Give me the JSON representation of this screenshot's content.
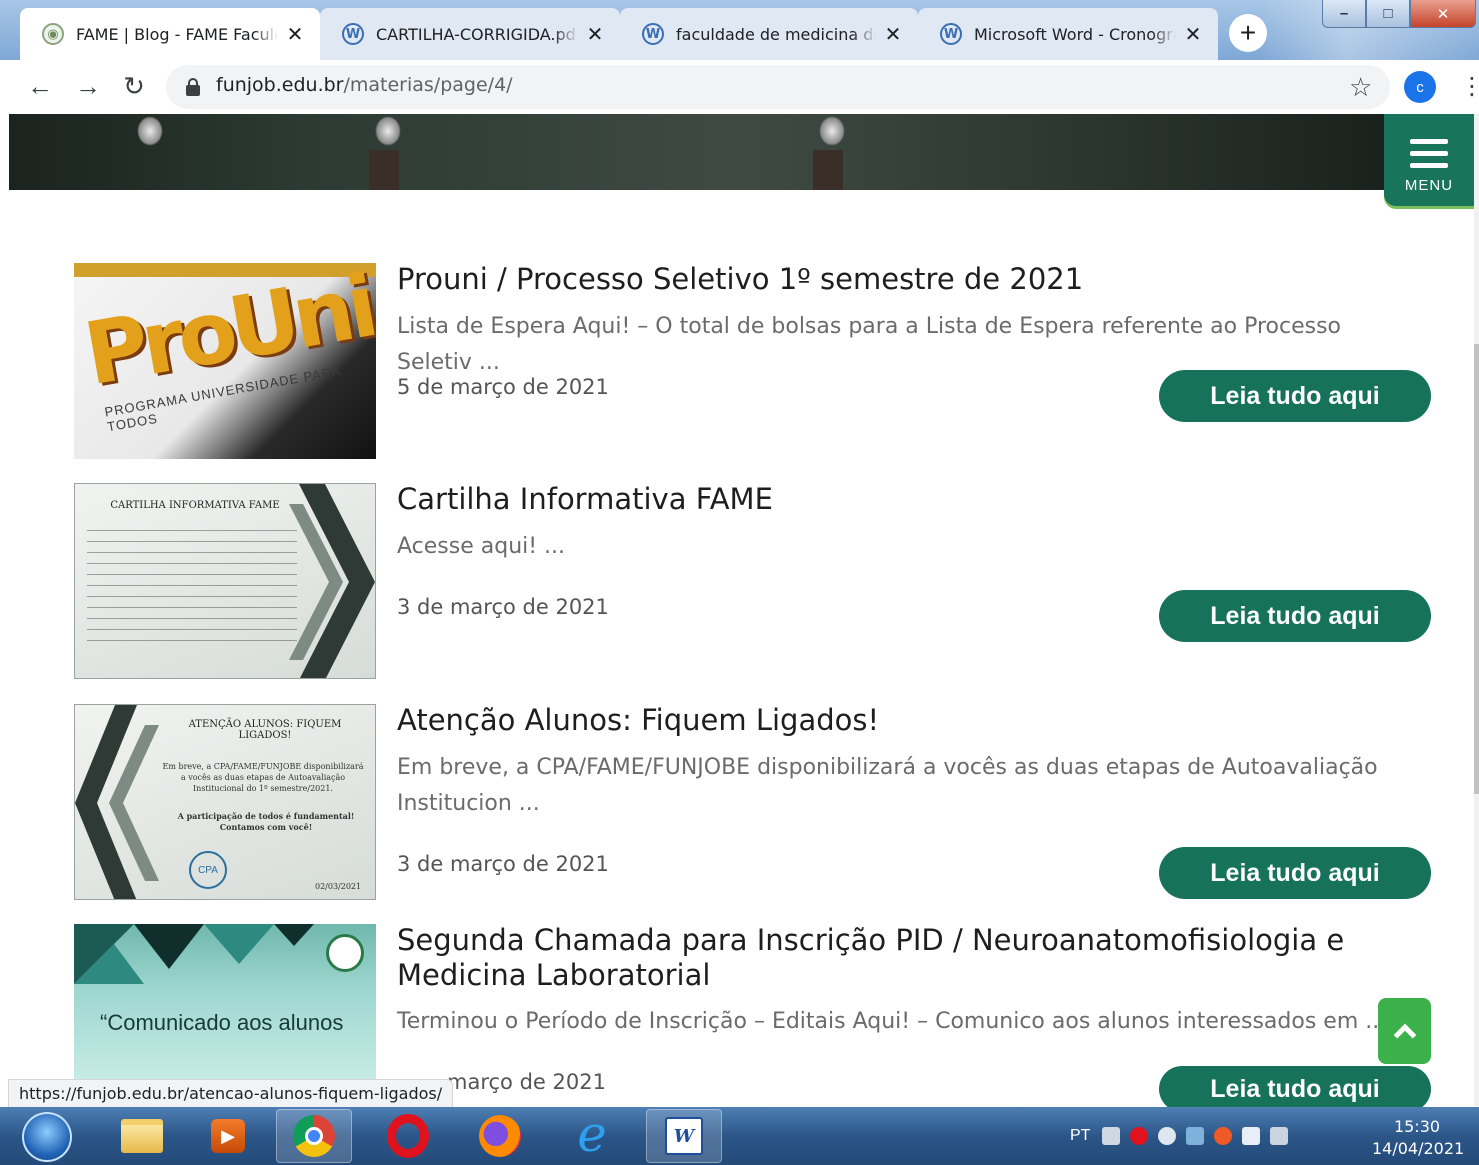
{
  "browser": {
    "tabs": [
      {
        "title": "FAME | Blog - FAME Faculdade",
        "icon": "fame-favicon",
        "active": true
      },
      {
        "title": "CARTILHA-CORRIGIDA.pdf",
        "icon": "wordpress-icon",
        "active": false
      },
      {
        "title": "faculdade de medicina de barbacena",
        "icon": "wordpress-icon",
        "active": false
      },
      {
        "title": "Microsoft Word - Cronograma",
        "icon": "wordpress-icon",
        "active": false
      }
    ],
    "new_tab": "+",
    "close_glyph": "✕",
    "url_host": "funjob.edu.br",
    "url_path": "/materias/page/4/",
    "profile_initial": "c",
    "window_controls": {
      "minimize": "–",
      "maximize": "□",
      "close": "✕"
    }
  },
  "page": {
    "menu_label": "MENU",
    "read_more_label": "Leia tudo aqui",
    "posts": [
      {
        "title": "Prouni / Processo Seletivo 1º semestre de 2021",
        "excerpt": "Lista de Espera Aqui! – O total de bolsas para a Lista de Espera referente ao Processo Seletiv ...",
        "date": "5 de março de 2021",
        "thumb": {
          "logo": "ProUni",
          "caption": "PROGRAMA UNIVERSIDADE PARA TODOS"
        }
      },
      {
        "title": "Cartilha Informativa FAME",
        "excerpt": "Acesse aqui! ...",
        "date": "3 de março de 2021",
        "thumb": {
          "heading": "CARTILHA INFORMATIVA FAME"
        }
      },
      {
        "title": "Atenção Alunos: Fiquem Ligados!",
        "excerpt": "Em breve, a CPA/FAME/FUNJOBE disponibilizará a vocês as duas etapas de Autoavaliação Institucion ...",
        "date": "3 de março de 2021",
        "thumb": {
          "heading": "ATENÇÃO ALUNOS: FIQUEM LIGADOS!",
          "body": "Em breve, a CPA/FAME/FUNJOBE disponibilizará a vocês as duas etapas de Autoavaliação Institucional do 1º semestre/2021.",
          "body2": "A participação de todos é fundamental! Contamos com você!",
          "badge": "CPA",
          "stamp": "02/03/2021"
        }
      },
      {
        "title": "Segunda Chamada para Inscrição PID / Neuroanatomofisiologia e Medicina Laboratorial",
        "excerpt": "Terminou o Período de Inscrição – Editais Aqui! – Comunico aos alunos interessados em ...",
        "date": "março de 2021",
        "thumb": {
          "caption": "“Comunicado aos alunos"
        }
      }
    ]
  },
  "status_bar": {
    "hover_url": "https://funjob.edu.br/atencao-alunos-fiquem-ligados/"
  },
  "taskbar": {
    "apps": [
      "start-orb",
      "explorer-icon",
      "media-player-icon",
      "chrome-icon",
      "opera-icon",
      "firefox-icon",
      "internet-explorer-icon",
      "word-icon"
    ],
    "language": "PT",
    "time": "15:30",
    "date": "14/04/2021"
  },
  "colors": {
    "accent_green": "#16735a",
    "scroll_top_green": "#3cb04b",
    "menu_green": "#18745a"
  }
}
